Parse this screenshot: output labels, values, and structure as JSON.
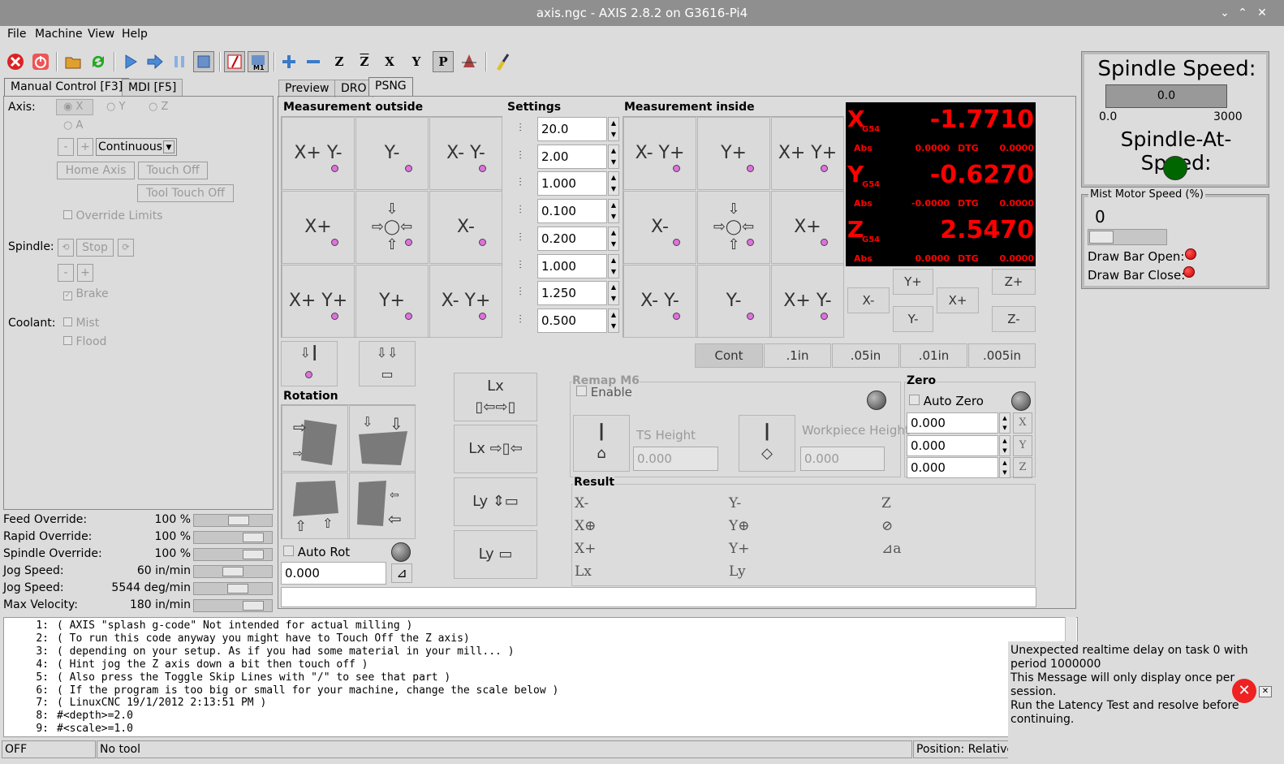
{
  "window": {
    "title": "axis.ngc - AXIS 2.8.2 on G3616-Pi4",
    "controls": [
      "⌄",
      "⌃",
      "✕"
    ]
  },
  "menu": [
    "File",
    "Machine",
    "View",
    "Help"
  ],
  "toolbar": {
    "icons": [
      "estop-icon",
      "power-icon",
      "open-file-icon",
      "reload-icon",
      "run-icon",
      "step-icon",
      "pause-icon",
      "stop-icon",
      "skip-lines-icon",
      "optional-stop-icon",
      "zoom-in-icon",
      "zoom-out-icon",
      "view-z-icon",
      "view-z2-icon",
      "view-x-icon",
      "view-y-icon",
      "view-p-icon",
      "rotate-icon",
      "clear-plot-icon"
    ],
    "views": [
      "Z",
      "Z",
      "X",
      "Y",
      "P"
    ],
    "m1": "M1"
  },
  "left_tabs": [
    "Manual Control [F3]",
    "MDI [F5]"
  ],
  "manual": {
    "axis_label": "Axis:",
    "axes": [
      "X",
      "Y",
      "Z",
      "A"
    ],
    "jog_minus": "-",
    "jog_plus": "+",
    "jog_mode": "Continuous",
    "home_axis": "Home Axis",
    "touch_off": "Touch Off",
    "tool_touch_off": "Tool Touch Off",
    "override_limits": "Override Limits",
    "spindle_label": "Spindle:",
    "spindle_stop": "Stop",
    "spindle_minus": "-",
    "spindle_plus": "+",
    "brake": "Brake",
    "coolant_label": "Coolant:",
    "mist": "Mist",
    "flood": "Flood"
  },
  "overrides": [
    {
      "label": "Feed Override:",
      "value": "100 %",
      "level": 0.6
    },
    {
      "label": "Rapid Override:",
      "value": "100 %",
      "level": 0.85
    },
    {
      "label": "Spindle Override:",
      "value": "100 %",
      "level": 0.85
    },
    {
      "label": "Jog Speed:",
      "value": "60 in/min",
      "level": 0.5
    },
    {
      "label": "Jog Speed:",
      "value": "5544 deg/min",
      "level": 0.58
    },
    {
      "label": "Max Velocity:",
      "value": "180 in/min",
      "level": 0.85
    }
  ],
  "right_tabs": [
    "Preview",
    "DRO",
    "PSNG"
  ],
  "psng": {
    "measure_outside": "Measurement outside",
    "settings": "Settings",
    "measure_inside": "Measurement inside",
    "outside_cells": [
      [
        "X+",
        "Y-"
      ],
      [
        "Y-"
      ],
      [
        "X-",
        "Y-"
      ],
      [
        "X+"
      ],
      [
        "center"
      ],
      [
        "X-"
      ],
      [
        "X+",
        "Y+"
      ],
      [
        "Y+"
      ],
      [
        "X-",
        "Y+"
      ]
    ],
    "inside_cells": [
      [
        "X-",
        "Y+"
      ],
      [
        "Y+"
      ],
      [
        "X+",
        "Y+"
      ],
      [
        "X-"
      ],
      [
        "center"
      ],
      [
        "X+"
      ],
      [
        "X-",
        "Y-"
      ],
      [
        "Y-"
      ],
      [
        "X+",
        "Y-"
      ]
    ],
    "settings_values": [
      "20.0",
      "2.00",
      "1.000",
      "0.100",
      "0.200",
      "1.000",
      "1.250",
      "0.500"
    ],
    "dro": [
      {
        "axis": "X",
        "cs": "G54",
        "value": "-1.7710",
        "abs_label": "Abs",
        "abs": "0.0000",
        "dtg_label": "DTG",
        "dtg": "0.0000"
      },
      {
        "axis": "Y",
        "cs": "G54",
        "value": "-0.6270",
        "abs_label": "Abs",
        "abs": "-0.0000",
        "dtg_label": "DTG",
        "dtg": "0.0000"
      },
      {
        "axis": "Z",
        "cs": "G54",
        "value": "2.5470",
        "abs_label": "Abs",
        "abs": "0.0000",
        "dtg_label": "DTG",
        "dtg": "0.0000"
      }
    ],
    "jog": {
      "yplus": "Y+",
      "xminus": "X-",
      "xplus": "X+",
      "yminus": "Y-",
      "zplus": "Z+",
      "zminus": "Z-"
    },
    "increments": [
      "Cont",
      ".1in",
      ".05in",
      ".01in",
      ".005in"
    ],
    "rotation": "Rotation",
    "auto_rot": "Auto Rot",
    "rot_value": "0.000",
    "lx": "Lx",
    "ly": "Ly",
    "remap": "Remap M6",
    "enable": "Enable",
    "ts_height": "TS Height",
    "ts_value": "0.000",
    "wp_height": "Workpiece Height",
    "wp_value": "0.000",
    "zero": "Zero",
    "auto_zero": "Auto Zero",
    "zero_values": [
      "0.000",
      "0.000",
      "0.000"
    ],
    "zero_axes": [
      "X",
      "Y",
      "Z"
    ],
    "result": "Result",
    "result_items": [
      [
        "X-",
        "Y-",
        "Z"
      ],
      [
        "X⊕",
        "Y⊕",
        "⊘"
      ],
      [
        "X+",
        "Y+",
        "⊿a"
      ],
      [
        "Lx",
        "Ly",
        ""
      ]
    ]
  },
  "spindle_panel": {
    "title": "Spindle Speed:",
    "speed": "0.0",
    "min": "0.0",
    "max": "3000",
    "at_speed": "Spindle-At-Speed:",
    "led_color": "#006600"
  },
  "mist_panel": {
    "title": "Mist Motor Speed (%)",
    "value": "0",
    "draw_bar_open": "Draw Bar Open:",
    "draw_bar_close": "Draw Bar Close:"
  },
  "gcode": [
    "1: ( AXIS \"splash g-code\" Not intended for actual milling )",
    "2: ( To run this code anyway you might have to Touch Off the Z axis)",
    "3: ( depending on your setup. As if you had some material in your mill... )",
    "4: ( Hint jog the Z axis down a bit then touch off )",
    "5: ( Also press the Toggle Skip Lines with \"/\" to see that part )",
    "6: ( If the program is too big or small for your machine, change the scale below )",
    "7: ( LinuxCNC 19/1/2012 2:13:51 PM )",
    "8: #<depth>=2.0",
    "9: #<scale>=1.0"
  ],
  "status": {
    "state": "OFF",
    "tool": "No tool",
    "position": "Position: Relative Actual"
  },
  "error": {
    "line1": "Unexpected realtime delay on task 0 with",
    "line2": "period 1000000",
    "line3": "This Message will only display once per",
    "line4": "session.",
    "line5": "Run the Latency Test and resolve before",
    "line6": "continuing.",
    "close": "✕"
  }
}
